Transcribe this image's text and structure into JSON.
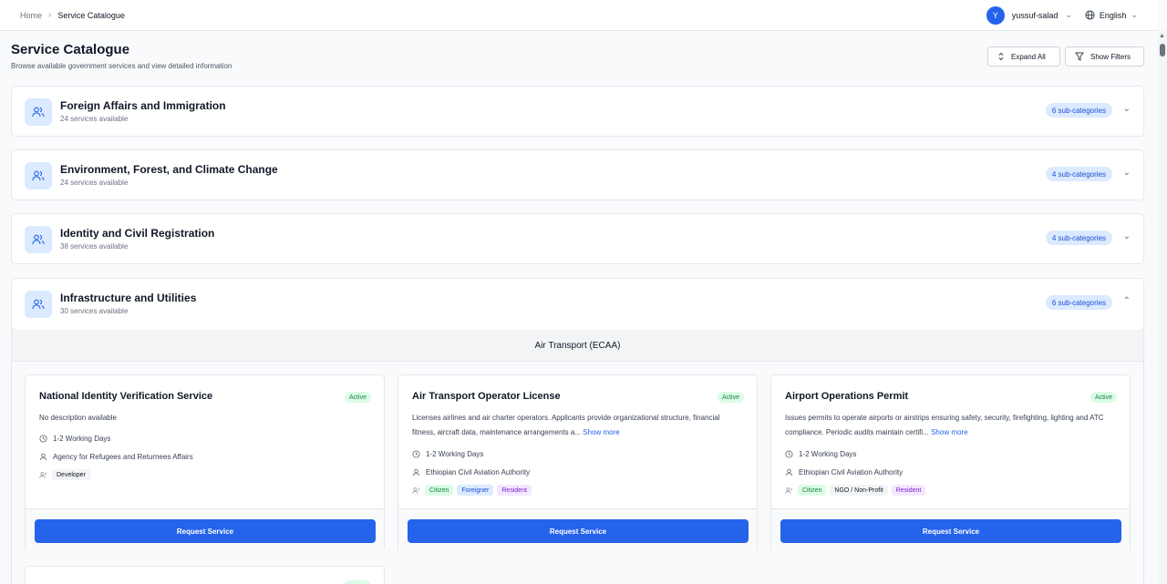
{
  "breadcrumb": [
    "Home",
    "Service Catalogue"
  ],
  "user": {
    "initial": "Y",
    "name": "yussuf-salad"
  },
  "language": "English",
  "header": {
    "title": "Service Catalogue",
    "subtitle": "Browse available government services and view detailed information",
    "expand_all": "Expand All",
    "show_filters": "Show Filters"
  },
  "categories": [
    {
      "name": "Foreign Affairs and Immigration",
      "count": "24 services available",
      "subcategories": "6 sub-categories",
      "expanded": false
    },
    {
      "name": "Environment, Forest, and Climate Change",
      "count": "24 services available",
      "subcategories": "4 sub-categories",
      "expanded": false
    },
    {
      "name": "Identity and Civil Registration",
      "count": "38 services available",
      "subcategories": "4 sub-categories",
      "expanded": false
    },
    {
      "name": "Infrastructure and Utilities",
      "count": "30 services available",
      "subcategories": "6 sub-categories",
      "expanded": true
    }
  ],
  "subcategory": "Air Transport (ECAA)",
  "services": [
    {
      "title": "National Identity Verification Service",
      "status": "Active",
      "description": "No description available",
      "more": "",
      "time": "1-2 Working Days",
      "agency": "Agency for Refugees and Returnees Affairs",
      "tags": [
        "Developer"
      ],
      "action": "Request Service"
    },
    {
      "title": "Air Transport Operator License",
      "status": "Active",
      "description": "Licenses airlines and air charter operators. Applicants provide organizational structure, financial fitness, aircraft data, maintenance arrangements a...",
      "more": "Show more",
      "time": "1-2 Working Days",
      "agency": "Ethiopian Civil Aviation Authority",
      "tags": [
        "Citizen",
        "Foreigner",
        "Resident"
      ],
      "action": "Request Service"
    },
    {
      "title": "Airport Operations Permit",
      "status": "Active",
      "description": "Issues permits to operate airports or airstrips ensuring safety, security, firefighting, lighting and ATC compliance. Periodic audits maintain certifi...",
      "more": "Show more",
      "time": "1-2 Working Days",
      "agency": "Ethiopian Civil Aviation Authority",
      "tags": [
        "Citizen",
        "NGO / Non-Profit",
        "Resident"
      ],
      "action": "Request Service"
    }
  ],
  "colors": {
    "primary": "#2563eb",
    "active_bg": "#dcfce7",
    "active_fg": "#15803d",
    "pill_bg": "#dbeafe"
  },
  "icons": {
    "category": "users-icon",
    "time": "clock-icon",
    "agency": "user-icon",
    "audience": "users-icon"
  }
}
